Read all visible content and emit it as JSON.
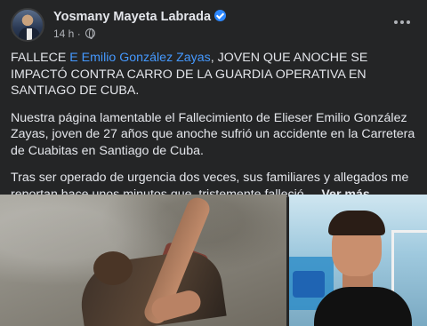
{
  "post": {
    "author": "Yosmany Mayeta Labrada",
    "time": "14 h",
    "verified_icon": "verified-badge-icon",
    "privacy_icon": "globe-icon",
    "menu_icon": "more-options-icon",
    "headline": {
      "prefix": "FALLECE ",
      "mention": "E Emilio González Zayas",
      "suffix": ", JOVEN QUE ANOCHE SE IMPACTÓ CONTRA CARRO DE LA GUARDIA OPERATIVA EN SANTIAGO DE CUBA."
    },
    "paragraph2": "Nuestra página lamentable el Fallecimiento de Elieser Emilio González Zayas, joven de 27 años que anoche sufrió un accidente en la Carretera de Cuabitas en Santiago de Cuba.",
    "paragraph3": "Tras ser operado de urgencia dos veces, sus familiares y allegados me reportan hace unos minutos que, tristemente falleció....",
    "see_more": "Ver más"
  },
  "colors": {
    "background": "#242526",
    "text": "#e4e6eb",
    "secondary_text": "#b0b3b8",
    "link": "#4599ff",
    "verified": "#2d88ff"
  }
}
